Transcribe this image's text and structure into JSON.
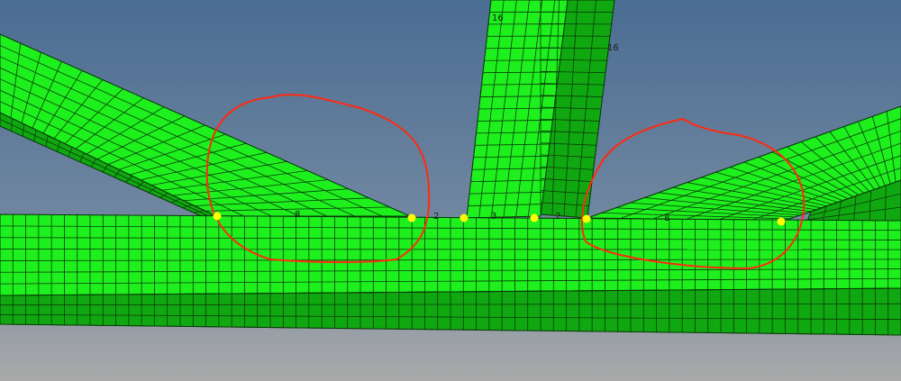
{
  "viewport": {
    "background_top": "#4a6d92",
    "background_bottom": "#a9a9a9",
    "mesh_color": "#1ef01e",
    "mesh_dark": "#10a810",
    "mesh_line": "#0a3a0a",
    "node_color": "#ffff00",
    "annotation_color": "#ff2a10"
  },
  "edge_labels": {
    "vertical_top": "16",
    "vertical_side": "16",
    "left_joint": "8",
    "gap_left": "2",
    "vertical_base": "3",
    "gap_right": "2",
    "right_joint": "8"
  }
}
